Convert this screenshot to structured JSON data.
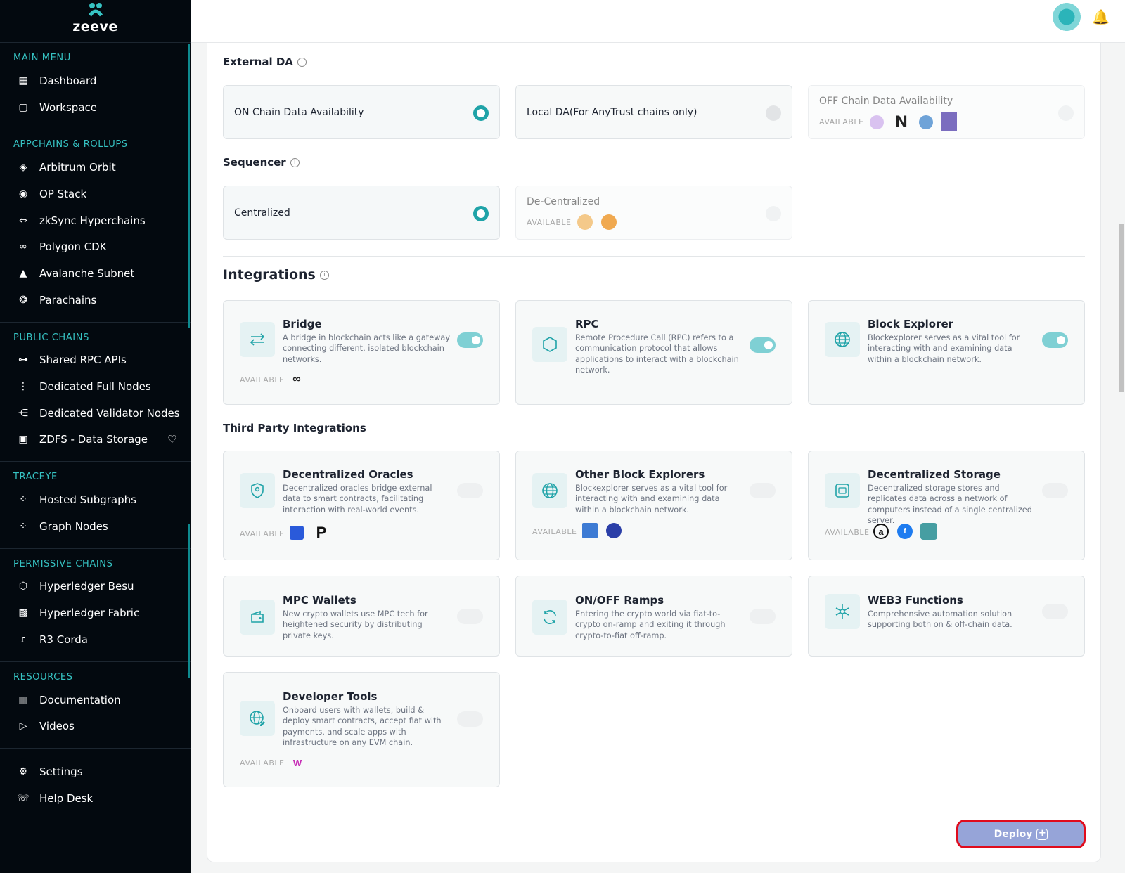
{
  "app": {
    "name": "zeeve"
  },
  "sidebar": {
    "sections": [
      {
        "title": "MAIN MENU",
        "items": [
          {
            "label": "Dashboard",
            "icon": "grid-icon"
          },
          {
            "label": "Workspace",
            "icon": "folder-icon"
          }
        ]
      },
      {
        "title": "APPCHAINS & ROLLUPS",
        "items": [
          {
            "label": "Arbitrum Orbit",
            "icon": "arbitrum-icon"
          },
          {
            "label": "OP Stack",
            "icon": "op-icon"
          },
          {
            "label": "zkSync Hyperchains",
            "icon": "zksync-icon"
          },
          {
            "label": "Polygon CDK",
            "icon": "polygon-icon"
          },
          {
            "label": "Avalanche Subnet",
            "icon": "avalanche-icon"
          },
          {
            "label": "Parachains",
            "icon": "polkadot-icon"
          }
        ]
      },
      {
        "title": "PUBLIC CHAINS",
        "items": [
          {
            "label": "Shared RPC APIs",
            "icon": "rpc-icon"
          },
          {
            "label": "Dedicated Full Nodes",
            "icon": "nodes-icon"
          },
          {
            "label": "Dedicated Validator Nodes",
            "icon": "validator-icon"
          },
          {
            "label": "ZDFS - Data Storage",
            "icon": "storage-icon"
          }
        ]
      },
      {
        "title": "TRACEYE",
        "items": [
          {
            "label": "Hosted Subgraphs",
            "icon": "subgraph-icon"
          },
          {
            "label": "Graph Nodes",
            "icon": "graph-icon"
          }
        ]
      },
      {
        "title": "PERMISSIVE CHAINS",
        "items": [
          {
            "label": "Hyperledger Besu",
            "icon": "besu-icon"
          },
          {
            "label": "Hyperledger Fabric",
            "icon": "fabric-icon"
          },
          {
            "label": "R3 Corda",
            "icon": "corda-icon"
          }
        ]
      },
      {
        "title": "RESOURCES",
        "items": [
          {
            "label": "Documentation",
            "icon": "book-icon"
          },
          {
            "label": "Videos",
            "icon": "video-icon"
          }
        ]
      },
      {
        "title": "",
        "items": [
          {
            "label": "Settings",
            "icon": "gear-icon"
          },
          {
            "label": "Help Desk",
            "icon": "phone-icon"
          }
        ]
      }
    ]
  },
  "external_da": {
    "label": "External DA",
    "options": [
      {
        "label": "ON Chain Data Availability",
        "selected": true
      },
      {
        "label": "Local DA(For AnyTrust chains only)",
        "selected": false
      },
      {
        "label": "OFF Chain Data Availability",
        "selected": false,
        "available_label": "AVAILABLE"
      }
    ]
  },
  "sequencer": {
    "label": "Sequencer",
    "options": [
      {
        "label": "Centralized",
        "selected": true
      },
      {
        "label": "De-Centralized",
        "selected": false,
        "available_label": "AVAILABLE"
      }
    ]
  },
  "integrations": {
    "title": "Integrations",
    "cards": [
      {
        "title": "Bridge",
        "desc": "A bridge in blockchain acts like a gateway connecting different, isolated blockchain networks.",
        "available_label": "AVAILABLE",
        "enabled": true
      },
      {
        "title": "RPC",
        "desc": "Remote Procedure Call (RPC) refers to a communication protocol that allows applications to interact with a blockchain network.",
        "enabled": true
      },
      {
        "title": "Block Explorer",
        "desc": "Blockexplorer serves as a vital tool for interacting with and examining data within a blockchain network.",
        "enabled": true
      }
    ]
  },
  "third_party": {
    "title": "Third Party Integrations",
    "cards": [
      {
        "title": "Decentralized Oracles",
        "desc": "Decentralized oracles bridge external data to smart contracts, facilitating interaction with real-world events.",
        "available_label": "AVAILABLE",
        "enabled": false
      },
      {
        "title": "Other Block Explorers",
        "desc": "Blockexplorer serves as a vital tool for interacting with and examining data within a blockchain network.",
        "available_label": "AVAILABLE",
        "enabled": false
      },
      {
        "title": "Decentralized Storage",
        "desc": "Decentralized storage stores and replicates data across a network of computers instead of a single centralized server.",
        "available_label": "AVAILABLE",
        "enabled": false
      },
      {
        "title": "MPC Wallets",
        "desc": "New crypto wallets use MPC tech for heightened security by distributing private keys.",
        "enabled": false
      },
      {
        "title": "ON/OFF Ramps",
        "desc": "Entering the crypto world via fiat-to-crypto on-ramp and exiting it through crypto-to-fiat off-ramp.",
        "enabled": false
      },
      {
        "title": "WEB3 Functions",
        "desc": "Comprehensive automation solution supporting both on & off-chain data.",
        "enabled": false
      },
      {
        "title": "Developer Tools",
        "desc": "Onboard users with wallets, build & deploy smart contracts, accept fiat with payments, and scale apps with infrastructure on any EVM chain.",
        "available_label": "AVAILABLE",
        "enabled": false
      }
    ]
  },
  "deploy": {
    "label": "Deploy"
  },
  "colors": {
    "accent": "#1fa3a8",
    "sidebar_bg": "#03090f",
    "deploy_bg": "#96a4d8",
    "highlight": "#e00b1c"
  }
}
